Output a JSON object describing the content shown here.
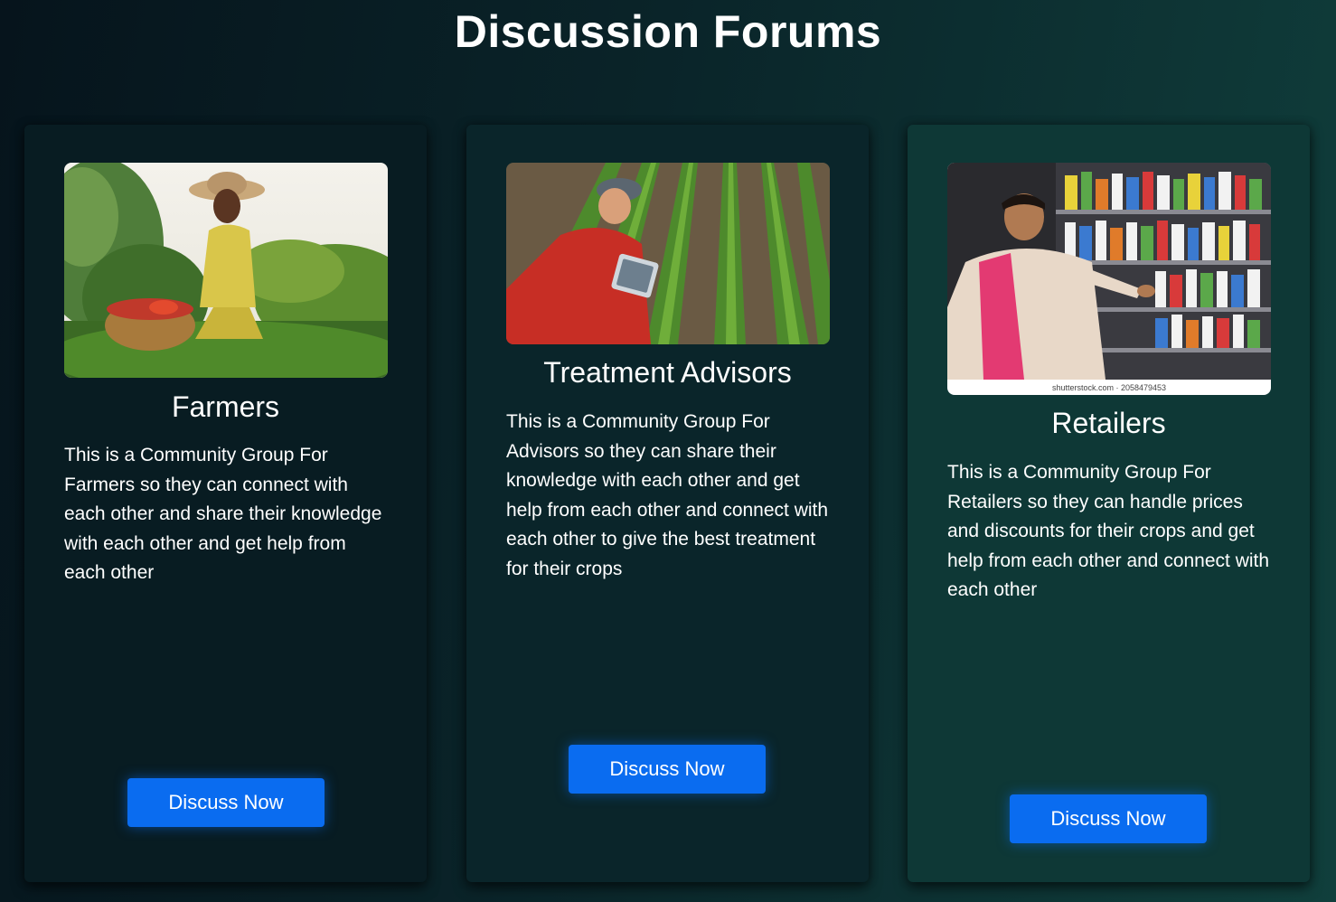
{
  "page": {
    "title": "Discussion Forums"
  },
  "forums": [
    {
      "title": "Farmers",
      "image": "farmer-harvesting-vegetables-photo",
      "description": "This is a Community Group For Farmers so they can connect with each other and share their knowledge with each other and get help from each other",
      "button_label": "Discuss Now"
    },
    {
      "title": "Treatment Advisors",
      "image": "advisor-inspecting-crop-rows-photo",
      "description": "This is a Community Group For Advisors so they can share their knowledge with each other and get help from each other and connect with each other to give the best treatment for their crops",
      "button_label": "Discuss Now"
    },
    {
      "title": "Retailers",
      "image": "retailer-in-agro-shop-photo",
      "image_caption": "shutterstock.com · 2058479453",
      "description": "This is a Community Group For Retailers so they can handle prices and discounts for their crops and get help from each other and connect with each other",
      "button_label": "Discuss Now"
    }
  ],
  "colors": {
    "button": "#0a6cf0",
    "card_left": "#081c22",
    "card_middle": "#0a252a",
    "card_right": "#0e3836",
    "text": "#ffffff"
  }
}
